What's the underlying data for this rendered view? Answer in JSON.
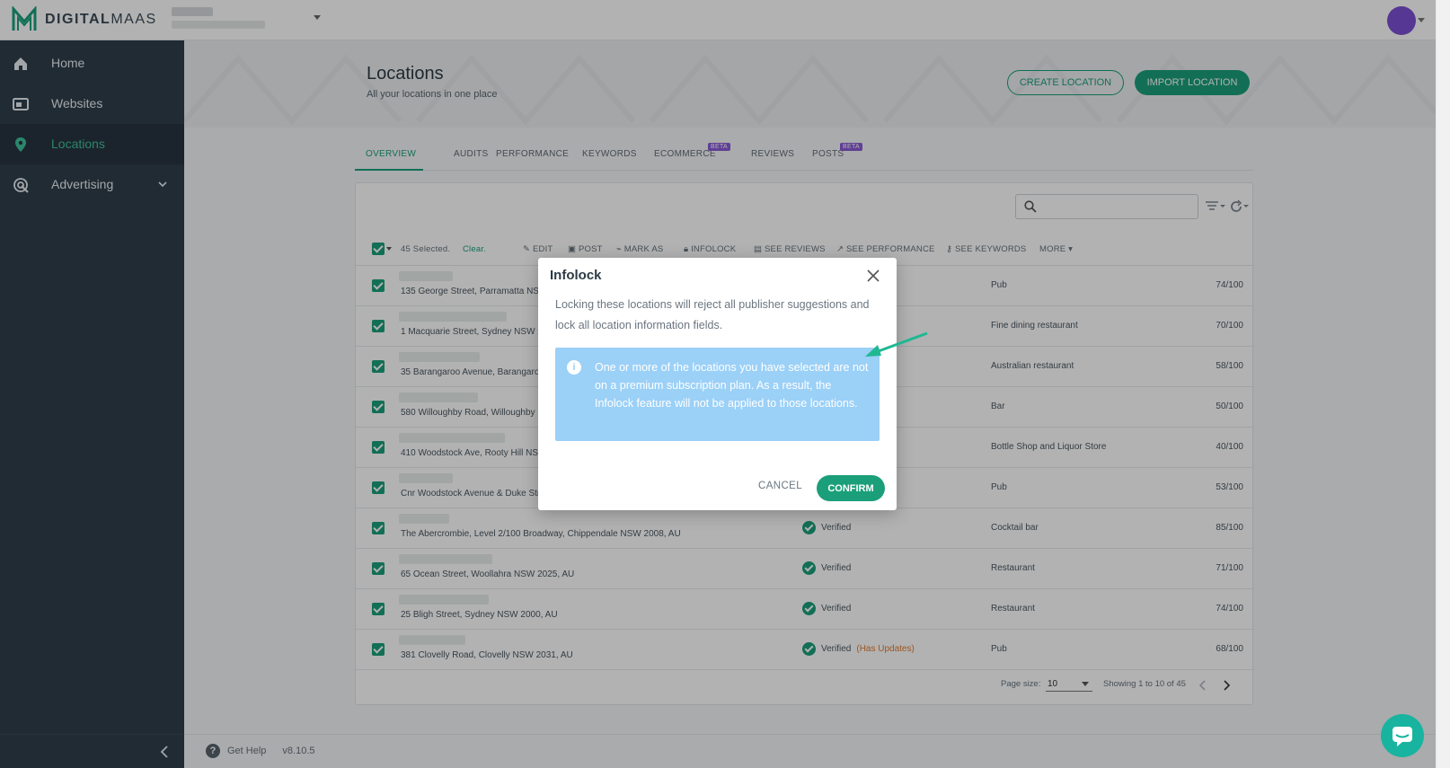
{
  "app": {
    "logo_text_bold": "DIGITAL",
    "logo_text_light": "MAAS"
  },
  "sidebar": {
    "items": [
      {
        "label": "Home",
        "icon": "home-icon"
      },
      {
        "label": "Websites",
        "icon": "websites-icon"
      },
      {
        "label": "Locations",
        "icon": "location-pin-icon",
        "active": true
      },
      {
        "label": "Advertising",
        "icon": "advertising-icon"
      }
    ]
  },
  "page": {
    "title": "Locations",
    "subtitle": "All your locations in one place",
    "create_label": "CREATE LOCATION",
    "import_label": "IMPORT LOCATION"
  },
  "tabs": [
    {
      "label": "OVERVIEW"
    },
    {
      "label": "AUDITS"
    },
    {
      "label": "PERFORMANCE"
    },
    {
      "label": "KEYWORDS"
    },
    {
      "label": "ECOMMERCE",
      "badge": "BETA"
    },
    {
      "label": "REVIEWS"
    },
    {
      "label": "POSTS",
      "badge": "BETA"
    }
  ],
  "selection": {
    "count_text": "45 Selected.",
    "clear_label": "Clear."
  },
  "actions": [
    "EDIT",
    "POST",
    "MARK AS",
    "INFOLOCK",
    "SEE REVIEWS",
    "SEE PERFORMANCE",
    "SEE KEYWORDS",
    "MORE"
  ],
  "rows": [
    {
      "address": "135 George Street, Parramatta NSW 2150, AU",
      "status": "",
      "category": "Pub",
      "score": "74/100"
    },
    {
      "address": "1 Macquarie Street, Sydney NSW 2000, AU",
      "status": "",
      "category": "Fine dining restaurant",
      "score": "70/100"
    },
    {
      "address": "35 Barangaroo Avenue, Barangaroo NSW 2000, AU",
      "status": "",
      "category": "Australian restaurant",
      "score": "58/100"
    },
    {
      "address": "580 Willoughby Road, Willoughby NSW 2068, AU",
      "status": "",
      "category": "Bar",
      "score": "50/100"
    },
    {
      "address": "410 Woodstock Ave, Rooty Hill NSW 2766, AU",
      "status": "",
      "category": "Bottle Shop and Liquor Store",
      "score": "40/100"
    },
    {
      "address": "Cnr Woodstock Avenue & Duke Street, Rooty Hill NSW 2766, AU",
      "status": "",
      "category": "Pub",
      "score": "53/100"
    },
    {
      "address": "The Abercrombie, Level 2/100 Broadway, Chippendale NSW 2008, AU",
      "status": "Verified",
      "category": "Cocktail bar",
      "score": "85/100"
    },
    {
      "address": "65 Ocean Street, Woollahra NSW 2025, AU",
      "status": "Verified",
      "category": "Restaurant",
      "score": "71/100"
    },
    {
      "address": "25 Bligh Street, Sydney NSW 2000, AU",
      "status": "Verified",
      "category": "Restaurant",
      "score": "74/100"
    },
    {
      "address": "381 Clovelly Road, Clovelly NSW 2031, AU",
      "status": "Verified",
      "updates": "(Has Updates)",
      "category": "Pub",
      "score": "68/100"
    }
  ],
  "pager": {
    "page_size_label": "Page size:",
    "page_size_value": "10",
    "showing_text": "Showing 1 to 10 of 45"
  },
  "footer": {
    "help_label": "Get Help",
    "version": "v8.10.5"
  },
  "modal": {
    "title": "Infolock",
    "body": "Locking these locations will reject all publisher suggestions and lock all location information fields.",
    "info": "One or more of the locations you have selected are not on a premium subscription plan. As a result, the Infolock feature will not be applied to those locations.",
    "cancel_label": "CANCEL",
    "confirm_label": "CONFIRM"
  },
  "colors": {
    "brand_green": "#1a9f7a",
    "sidebar_bg": "#2f3e4b",
    "info_blue": "#9bd0f7",
    "beta_purple": "#8a5bd6"
  }
}
